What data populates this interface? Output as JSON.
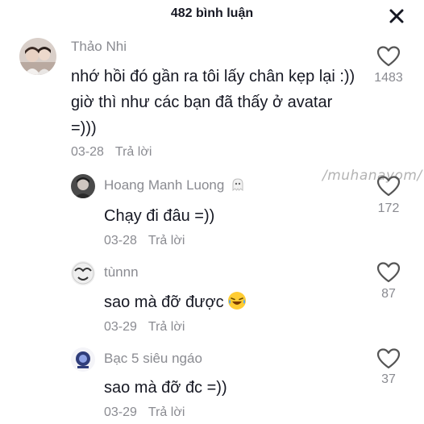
{
  "header": {
    "title": "482 bình luận",
    "close_icon": "close-icon"
  },
  "watermark": "/muhanayom/",
  "comments": [
    {
      "user": "Thảo Nhi",
      "text": "nhớ hồi đó gần ra tôi lấy chân kẹp lại :)) giờ thì như các bạn đã thấy ở avatar =)))",
      "date": "03-28",
      "reply": "Trả lời",
      "likes": "1483"
    },
    {
      "user": "Hoang Manh Luong",
      "text": "Chạy đi đâu =))",
      "date": "03-28",
      "reply": "Trả lời",
      "likes": "172"
    },
    {
      "user": "tùnnn",
      "text": "sao mà đỡ được",
      "date": "03-29",
      "reply": "Trả lời",
      "likes": "87"
    },
    {
      "user": "Bạc 5 siêu ngáo",
      "text": "sao mà đỡ đc =))",
      "date": "03-29",
      "reply": "Trả lời",
      "likes": "37"
    }
  ],
  "colors": {
    "text": "#161823",
    "muted": "#8a8b91",
    "icon": "#555555"
  }
}
